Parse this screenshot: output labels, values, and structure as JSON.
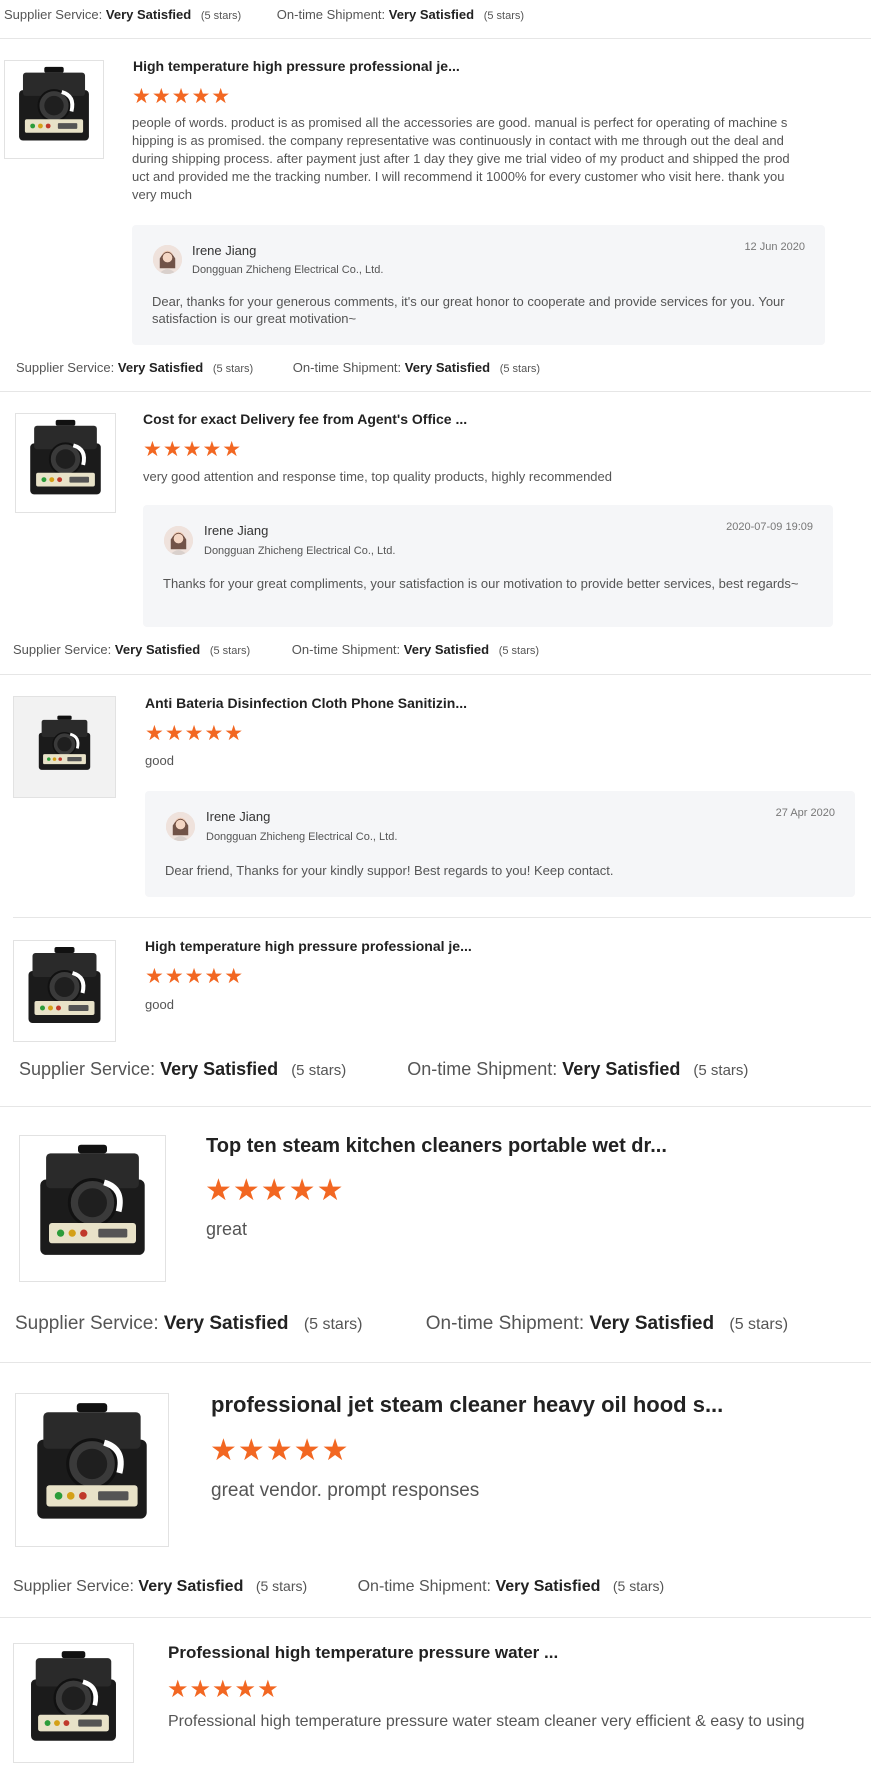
{
  "colors": {
    "star": "#f26722",
    "reply_bg": "#f5f6f8",
    "divider": "#e6e6e6"
  },
  "labels": {
    "supplier_service": "Supplier Service:",
    "ontime_shipment": "On-time Shipment:"
  },
  "reviews": [
    {
      "supplier_value": "Very Satisfied",
      "supplier_stars": "(5 stars)",
      "shipment_value": "Very Satisfied",
      "shipment_stars": "(5 stars)"
    },
    {
      "product_title": "High temperature high pressure professional je...",
      "stars": "★★★★★",
      "product_icon": "steam-cleaner-icon",
      "comment": "people of words. product is as promised all the accessories are good. manual is perfect for operating of machine shipping is as promised. the company representative was continuously in contact with me through out the deal and during shipping process. after payment just after 1 day they give me trial video of my product and shipped the product and provided me the tracking number. I will recommend it 1000% for every customer who visit here. thank you very much",
      "reply": {
        "name": "Irene Jiang",
        "company": "Dongguan Zhicheng Electrical Co., Ltd.",
        "date": "12 Jun 2020",
        "message": "Dear, thanks for your generous comments, it's our great honor to cooperate and provide services for you. Your satisfaction is our great motivation~"
      },
      "supplier_value": "Very Satisfied",
      "supplier_stars": "(5 stars)",
      "shipment_value": "Very Satisfied",
      "shipment_stars": "(5 stars)"
    },
    {
      "product_title": "Cost for exact Delivery fee from Agent's Office ...",
      "stars": "★★★★★",
      "product_icon": "steam-cleaner-icon",
      "comment": "very good attention and response time, top quality products, highly recommended",
      "reply": {
        "name": "Irene Jiang",
        "company": "Dongguan Zhicheng Electrical Co., Ltd.",
        "date": "2020-07-09 19:09",
        "message": "Thanks for  your great compliments,  your satisfaction is our motivation to provide better services, best regards~"
      },
      "supplier_value": "Very Satisfied",
      "supplier_stars": "(5 stars)",
      "shipment_value": "Very Satisfied",
      "shipment_stars": "(5 stars)"
    },
    {
      "product_title": "Anti Bateria Disinfection Cloth Phone Sanitizin...",
      "stars": "★★★★★",
      "product_icon": "steam-cleaner-icon",
      "comment": "good",
      "reply": {
        "name": "Irene Jiang",
        "company": "Dongguan Zhicheng Electrical Co., Ltd.",
        "date": "27 Apr 2020",
        "message": "Dear friend, Thanks for your kindly suppor!  Best regards to you! Keep contact."
      }
    },
    {
      "product_title": "High temperature high pressure professional je...",
      "stars": "★★★★★",
      "product_icon": "steam-cleaner-icon",
      "comment": "good",
      "supplier_value": "Very Satisfied",
      "supplier_stars": "(5 stars)",
      "shipment_value": "Very Satisfied",
      "shipment_stars": "(5 stars)"
    },
    {
      "product_title": "Top ten steam kitchen cleaners portable wet dr...",
      "stars": "★★★★★",
      "product_icon": "steam-cleaner-icon",
      "comment": "great",
      "supplier_value": "Very Satisfied",
      "supplier_stars": "(5 stars)",
      "shipment_value": "Very Satisfied",
      "shipment_stars": "(5 stars)"
    },
    {
      "product_title": "professional jet steam cleaner heavy oil hood s...",
      "stars": "★★★★★",
      "product_icon": "steam-cleaner-icon",
      "comment": "great vendor. prompt responses",
      "supplier_value": "Very Satisfied",
      "supplier_stars": "(5 stars)",
      "shipment_value": "Very Satisfied",
      "shipment_stars": "(5 stars)"
    },
    {
      "product_title": "Professional high temperature pressure water ...",
      "stars": "★★★★★",
      "product_icon": "steam-cleaner-icon",
      "comment": "Professional high temperature pressure water steam cleaner very efficient & easy to using"
    }
  ]
}
